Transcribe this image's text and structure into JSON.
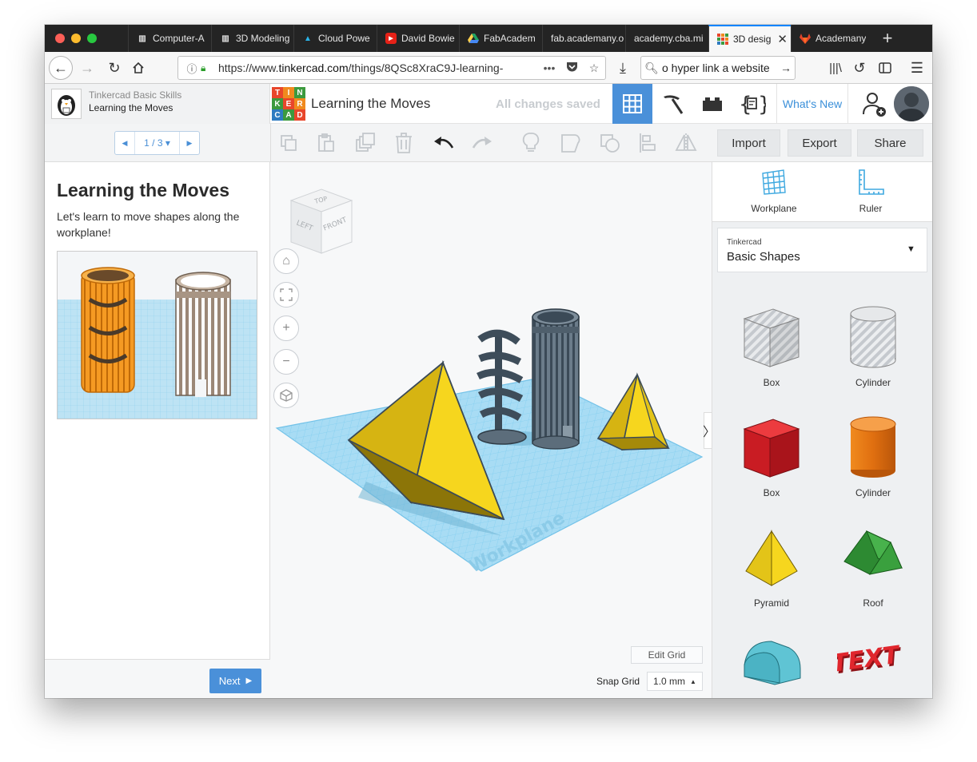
{
  "browser": {
    "tabs": [
      {
        "label": "Computer-A",
        "icon": "youtube-studio-icon"
      },
      {
        "label": "3D Modeling",
        "icon": "youtube-studio-icon"
      },
      {
        "label": "Cloud Powe",
        "icon": "autodesk-icon"
      },
      {
        "label": "David Bowie",
        "icon": "youtube-icon"
      },
      {
        "label": "FabAcadem",
        "icon": "google-drive-icon"
      },
      {
        "label": "fab.academany.o",
        "icon": "none"
      },
      {
        "label": "academy.cba.mi",
        "icon": "none"
      },
      {
        "label": "3D desig",
        "icon": "tinkercad-icon"
      },
      {
        "label": "Academany",
        "icon": "gitlab-icon"
      }
    ],
    "url_prefix": "https://www.",
    "url_domain": "tinkercad.com",
    "url_path": "/things/8QSc8XraC9J-learning-",
    "search_value": "o hyper link a website"
  },
  "app": {
    "lesson_course": "Tinkercad Basic Skills",
    "lesson_name": "Learning the Moves",
    "logo_letters": [
      "T",
      "I",
      "N",
      "K",
      "E",
      "R",
      "C",
      "A",
      "D"
    ],
    "logo_colors": [
      "#e8462b",
      "#f08a1e",
      "#3c9a3e",
      "#3c9a3e",
      "#e8462b",
      "#f08a1e",
      "#2f7bc0",
      "#3c9a3e",
      "#e8462b"
    ],
    "design_title": "Learning the Moves",
    "save_status": "All changes saved",
    "whats_new": "What's New",
    "accent": "#4a90d9"
  },
  "toolbar": {
    "pager": "1 / 3",
    "import": "Import",
    "export": "Export",
    "share": "Share"
  },
  "lesson": {
    "title": "Learning the Moves",
    "description": "Let's learn to move shapes along the workplane!",
    "next": "Next"
  },
  "canvas": {
    "viewcube": {
      "top": "TOP",
      "left": "LEFT",
      "front": "FRONT"
    },
    "workplane_label": "Workplane",
    "edit_grid": "Edit Grid",
    "snap_grid_label": "Snap Grid",
    "snap_grid_value": "1.0 mm"
  },
  "right_panel": {
    "workplane": "Workplane",
    "ruler": "Ruler",
    "category_source": "Tinkercad",
    "category": "Basic Shapes",
    "shapes": [
      {
        "label": "Box",
        "color": "#b8bcc2"
      },
      {
        "label": "Cylinder",
        "color": "#c4c8cc"
      },
      {
        "label": "Box",
        "color": "#d9232b"
      },
      {
        "label": "Cylinder",
        "color": "#ef7d1a"
      },
      {
        "label": "Pyramid",
        "color": "#f2c81c"
      },
      {
        "label": "Roof",
        "color": "#3aa03e"
      },
      {
        "label": "",
        "color": "#5fc4d4"
      },
      {
        "label": "TEXT",
        "color": "#d2232a"
      }
    ]
  }
}
